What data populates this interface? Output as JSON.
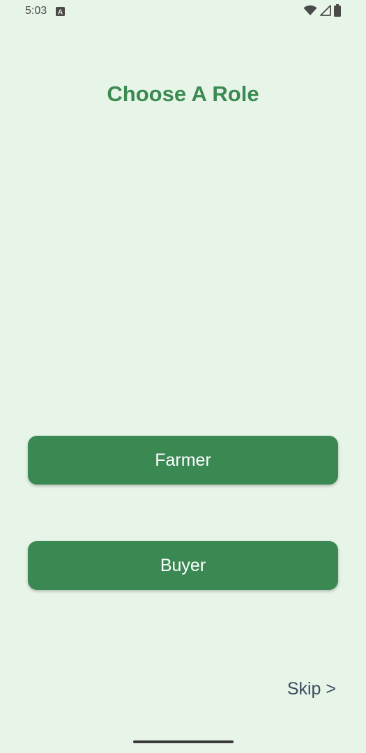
{
  "status_bar": {
    "time": "5:03",
    "notification_icon": "a-badge-icon",
    "icons": [
      "wifi-icon",
      "signal-icon",
      "battery-icon"
    ]
  },
  "screen": {
    "title": "Choose A Role",
    "buttons": {
      "farmer_label": "Farmer",
      "buyer_label": "Buyer"
    },
    "skip_label": "Skip >"
  },
  "colors": {
    "background": "#e7f4e8",
    "primary": "#3a8852",
    "title": "#3a8a52",
    "skip_text": "#3c4a5e"
  }
}
